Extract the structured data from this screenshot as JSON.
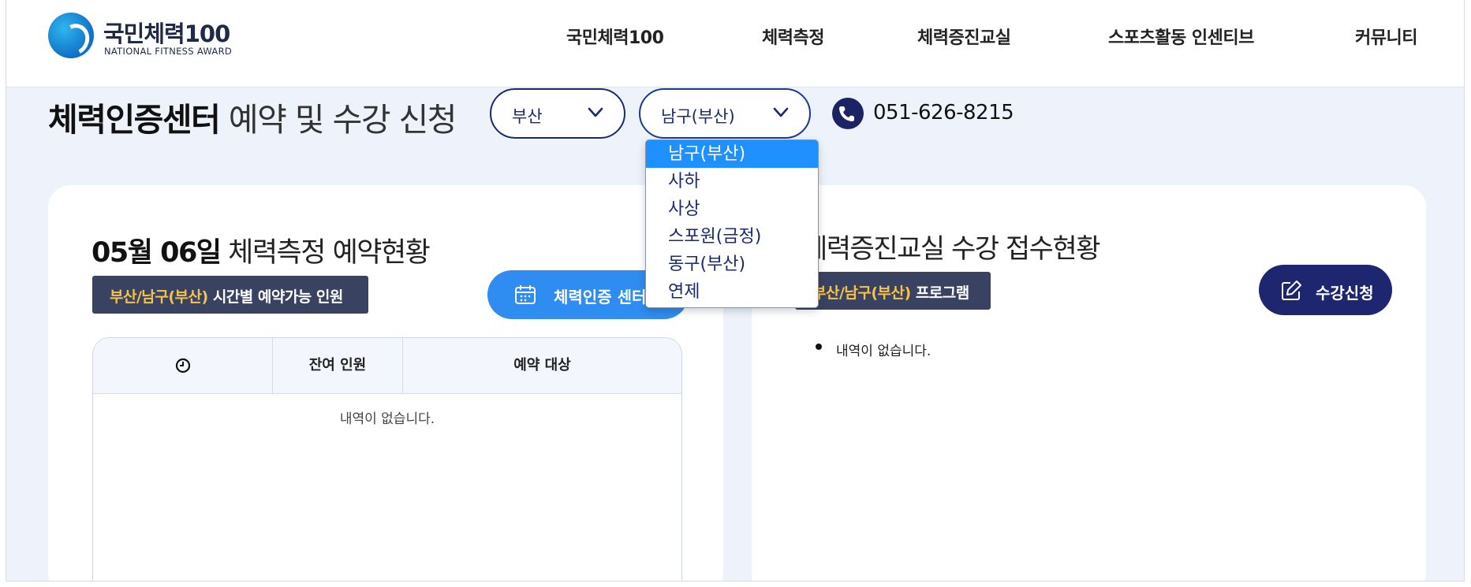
{
  "header": {
    "logo_title": "국민체력100",
    "logo_subtitle": "NATIONAL FITNESS AWARD",
    "nav": [
      "국민체력100",
      "체력측정",
      "체력증진교실",
      "스포츠활동 인센티브",
      "커뮤니티"
    ]
  },
  "page": {
    "title_bold": "체력인증센터",
    "title_rest": "예약 및 수강 신청",
    "region_select": "부산",
    "district_select": "남구(부산)",
    "phone": "051-626-8215"
  },
  "dropdown": {
    "options": [
      "남구(부산)",
      "사하",
      "사상",
      "스포원(금정)",
      "동구(부산)",
      "연제"
    ],
    "selected_index": 0
  },
  "left_panel": {
    "date": "05월 06일",
    "title_rest": "체력측정 예약현황",
    "badge_highlight": "부산/남구(부산)",
    "badge_text": "시간별 예약가능 인원",
    "center_button": "체력인증 센터이",
    "table_headers": [
      "잔여 인원",
      "예약 대상"
    ],
    "empty_message": "내역이 없습니다."
  },
  "right_panel": {
    "title": "체력증진교실 수강 접수현황",
    "badge_highlight": "부산/남구(부산)",
    "badge_text": "프로그램",
    "apply_button": "수강신청",
    "list_items": [
      "내역이 없습니다."
    ]
  },
  "colors": {
    "navy": "#1a2364",
    "blue_button": "#2f8cf0",
    "badge_bg": "#3a4262",
    "badge_highlight": "#f6c34a",
    "dropdown_selected": "#1e90ff",
    "page_bg": "#edf2fb"
  }
}
